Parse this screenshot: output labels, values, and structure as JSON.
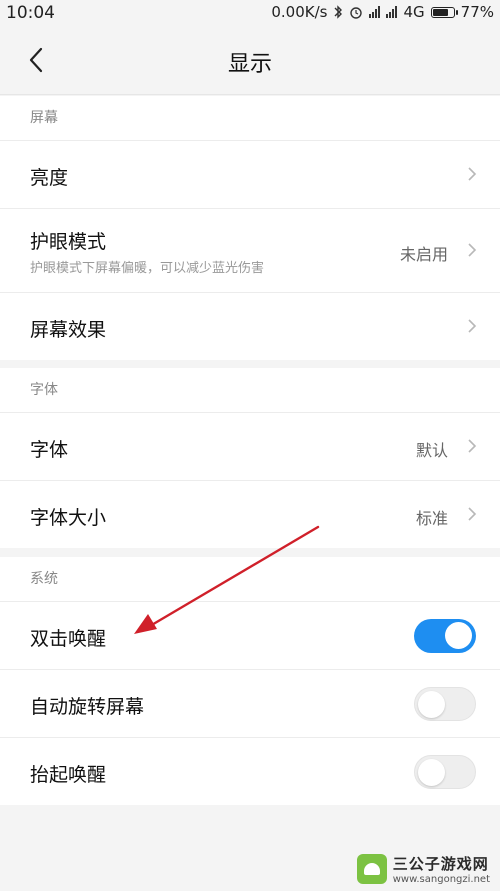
{
  "status_bar": {
    "time": "10:04",
    "network_speed": "0.00K/s",
    "network_type": "4G",
    "battery_percent": "77%",
    "battery_level": 0.77
  },
  "header": {
    "title": "显示",
    "back_icon": "chevron-left-icon"
  },
  "sections": {
    "screen": {
      "header": "屏幕",
      "brightness": {
        "label": "亮度"
      },
      "eye_care": {
        "label": "护眼模式",
        "subtitle": "护眼模式下屏幕偏暖，可以减少蓝光伤害",
        "value": "未启用"
      },
      "screen_effect": {
        "label": "屏幕效果"
      }
    },
    "font": {
      "header": "字体",
      "font_face": {
        "label": "字体",
        "value": "默认"
      },
      "font_size": {
        "label": "字体大小",
        "value": "标准"
      }
    },
    "system": {
      "header": "系统",
      "double_tap_wake": {
        "label": "双击唤醒",
        "enabled": true
      },
      "auto_rotate": {
        "label": "自动旋转屏幕",
        "enabled": false
      },
      "lift_to_wake": {
        "label": "抬起唤醒",
        "enabled": false
      }
    }
  },
  "annotation": {
    "color": "#d0202a"
  },
  "accent_color": "#1e8ef1",
  "watermark": {
    "title": "三公子游戏网",
    "url": "www.sangongzi.net"
  }
}
